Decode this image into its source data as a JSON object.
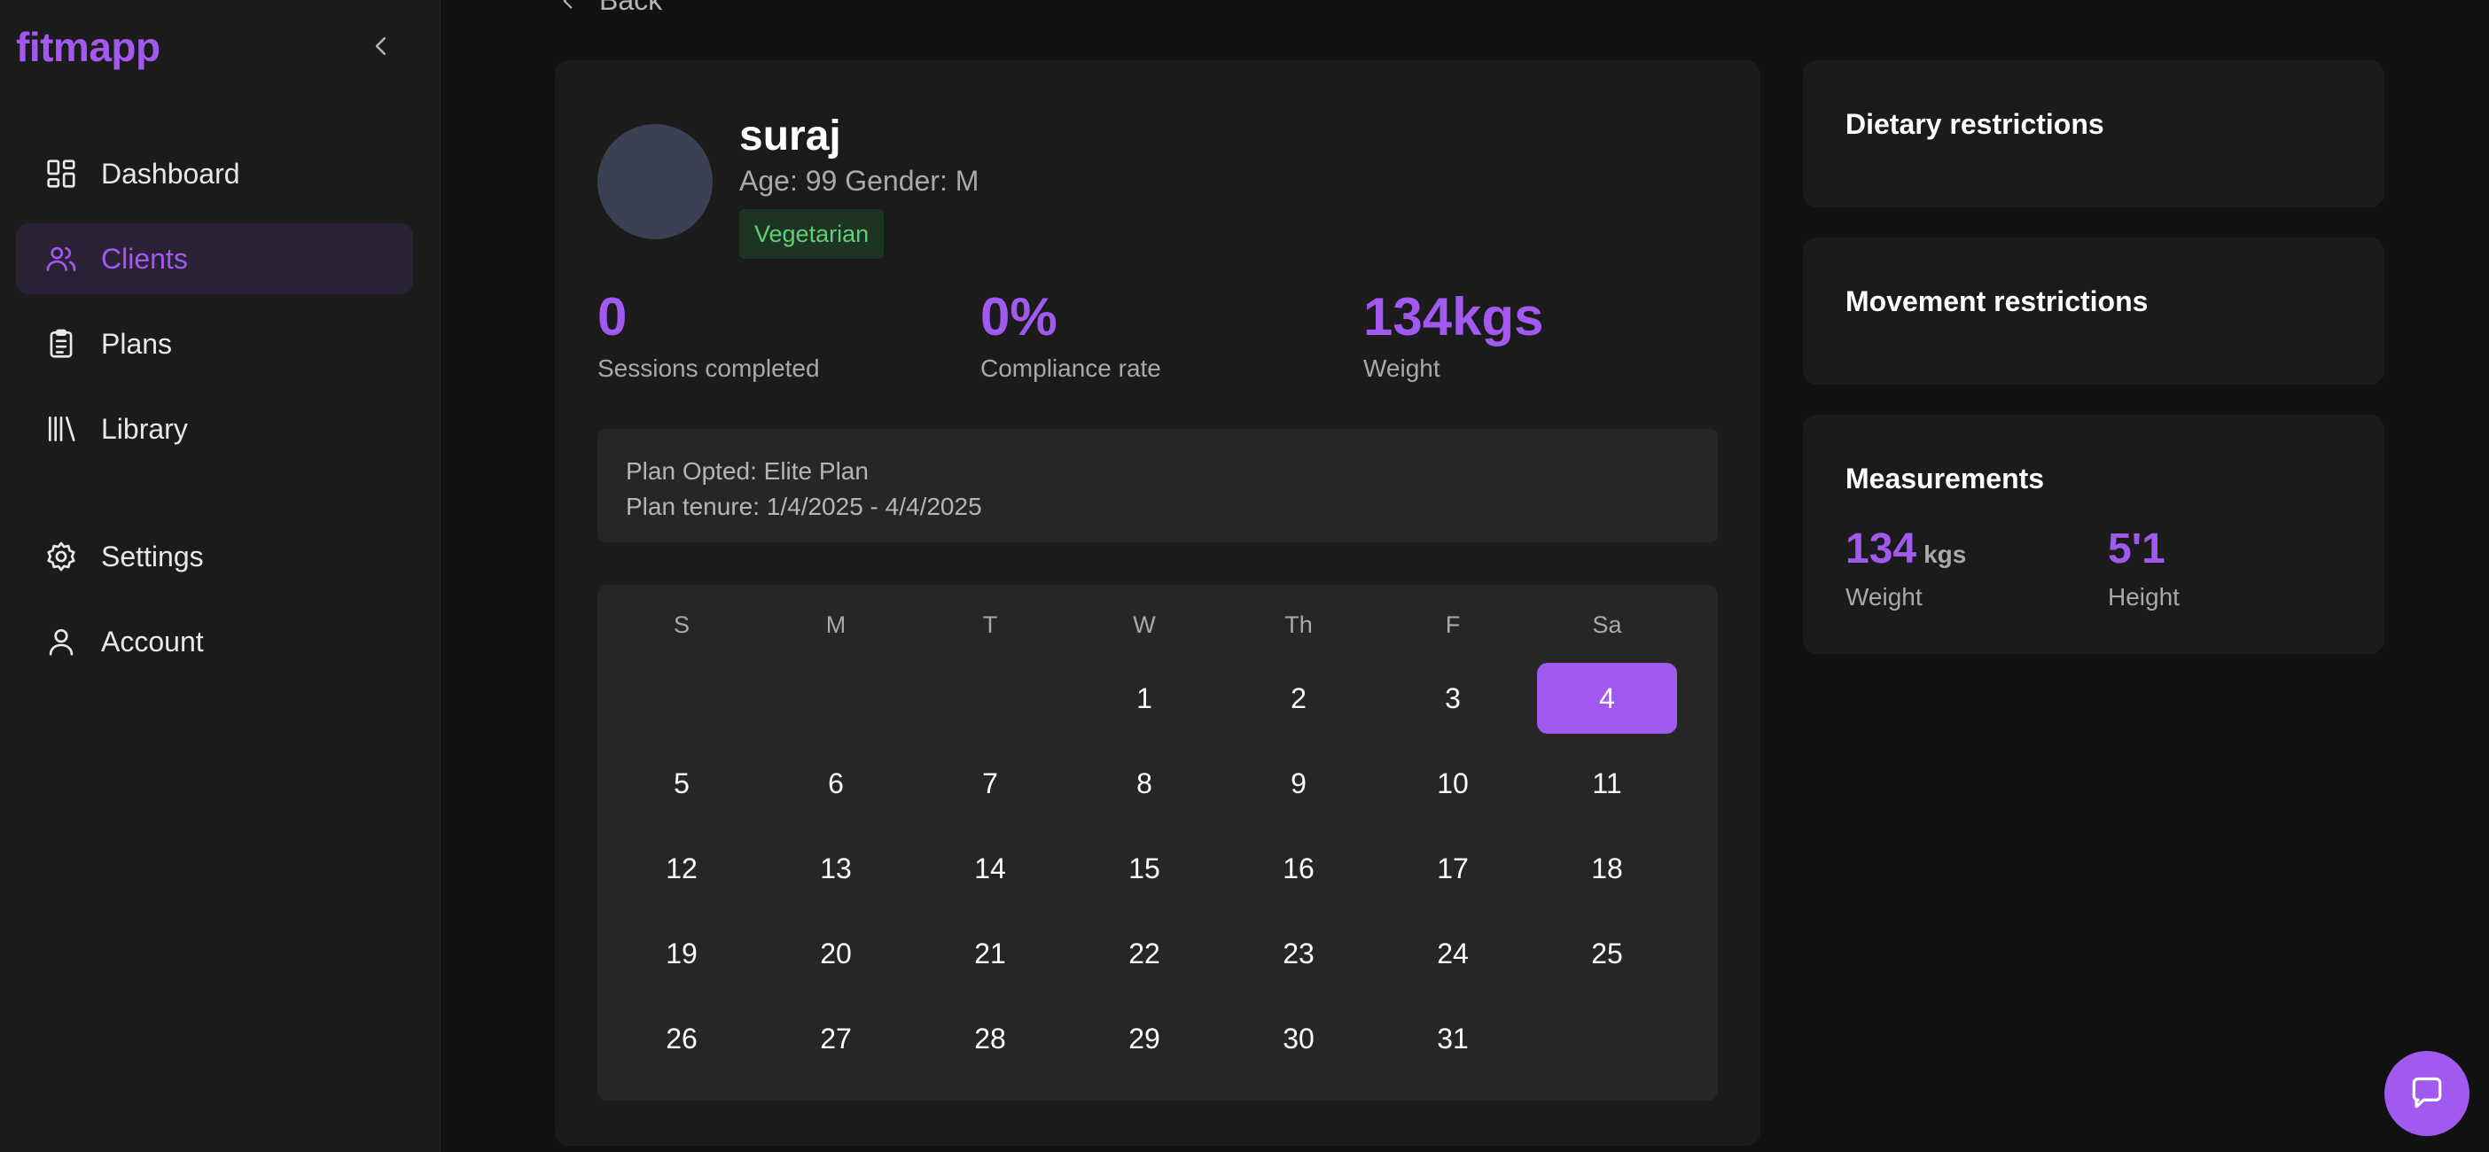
{
  "app": {
    "logo": "fitmapp"
  },
  "sidebar": {
    "items": [
      {
        "label": "Dashboard",
        "icon": "dashboard-icon",
        "active": false
      },
      {
        "label": "Clients",
        "icon": "users-icon",
        "active": true
      },
      {
        "label": "Plans",
        "icon": "clipboard-icon",
        "active": false
      },
      {
        "label": "Library",
        "icon": "library-icon",
        "active": false
      },
      {
        "label": "Settings",
        "icon": "gear-icon",
        "active": false
      },
      {
        "label": "Account",
        "icon": "user-icon",
        "active": false
      }
    ]
  },
  "back": {
    "label": "Back"
  },
  "client": {
    "name": "suraj",
    "meta": "Age: 99 Gender: M",
    "diet_badge": "Vegetarian",
    "stats": [
      {
        "value": "0",
        "label": "Sessions completed"
      },
      {
        "value": "0%",
        "label": "Compliance rate"
      },
      {
        "value": "134kgs",
        "label": "Weight"
      }
    ],
    "plan": {
      "opted": "Plan Opted: Elite Plan",
      "tenure": "Plan tenure: 1/4/2025 - 4/4/2025"
    }
  },
  "calendar": {
    "weekdays": [
      "S",
      "M",
      "T",
      "W",
      "Th",
      "F",
      "Sa"
    ],
    "first_weekday_index": 3,
    "days_in_month": 31,
    "selected_day": 4,
    "days": [
      "1",
      "2",
      "3",
      "4",
      "5",
      "6",
      "7",
      "8",
      "9",
      "10",
      "11",
      "12",
      "13",
      "14",
      "15",
      "16",
      "17",
      "18",
      "19",
      "20",
      "21",
      "22",
      "23",
      "24",
      "25",
      "26",
      "27",
      "28",
      "29",
      "30",
      "31"
    ]
  },
  "side": {
    "dietary_title": "Dietary restrictions",
    "movement_title": "Movement restrictions",
    "measurements_title": "Measurements",
    "weight": {
      "value": "134",
      "unit": "kgs",
      "label": "Weight"
    },
    "height": {
      "value": "5'1",
      "label": "Height"
    }
  },
  "colors": {
    "accent": "#a259f0",
    "background": "#111111",
    "card": "#1b1b1b",
    "badge_bg": "#1f3324",
    "badge_text": "#5fcf76"
  }
}
